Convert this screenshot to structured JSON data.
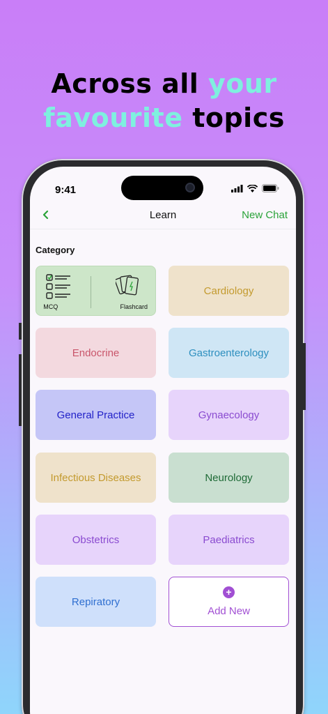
{
  "headline": {
    "line1_a": "Across all ",
    "line1_b": "your",
    "line2_a": "favourite",
    "line2_b": " topics"
  },
  "status": {
    "time": "9:41"
  },
  "nav": {
    "back": "‹",
    "title": "Learn",
    "new_chat": "New Chat"
  },
  "category_title": "Category",
  "mcq_tile": {
    "mcq_label": "MCQ",
    "flashcard_label": "Flashcard"
  },
  "tiles": [
    {
      "label": "Cardiology",
      "bg": "#efe2cb",
      "color": "#c39a2e"
    },
    {
      "label": "Endocrine",
      "bg": "#f3d9df",
      "color": "#c9566b"
    },
    {
      "label": "Gastroenterology",
      "bg": "#cfe6f5",
      "color": "#2d8fbf"
    },
    {
      "label": "General Practice",
      "bg": "#c5c6f7",
      "color": "#2222c8"
    },
    {
      "label": "Gynaecology",
      "bg": "#e7d4fb",
      "color": "#8a4bd0"
    },
    {
      "label": "Infectious Diseases",
      "bg": "#efe2cb",
      "color": "#c39a2e"
    },
    {
      "label": "Neurology",
      "bg": "#c9dfd0",
      "color": "#1f6b37"
    },
    {
      "label": "Obstetrics",
      "bg": "#e7d4fb",
      "color": "#8a4bd0"
    },
    {
      "label": "Paediatrics",
      "bg": "#e7d4fb",
      "color": "#8a4bd0"
    },
    {
      "label": "Repiratory",
      "bg": "#cfe0fb",
      "color": "#2f6fd0"
    }
  ],
  "add_tile": {
    "icon": "plus-icon",
    "label": "Add New"
  }
}
